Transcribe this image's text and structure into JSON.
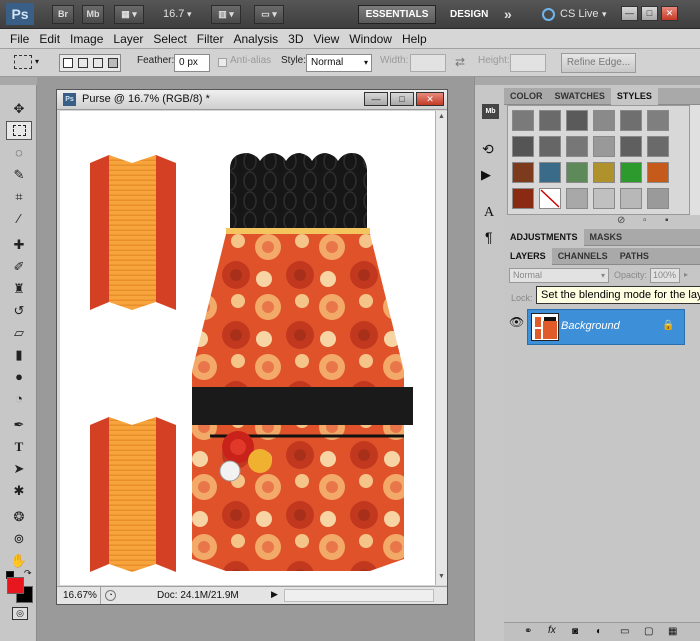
{
  "app": {
    "logo": "Ps",
    "bridge": "Br",
    "minibridge": "Mb",
    "zoom": "16.7",
    "workspace": "ESSENTIALS",
    "design": "DESIGN",
    "more": "»",
    "cslive": "CS Live",
    "cslive_arrow": "▾",
    "win_min": "—",
    "win_max": "□",
    "win_close": "✕"
  },
  "menu": [
    "File",
    "Edit",
    "Image",
    "Layer",
    "Select",
    "Filter",
    "Analysis",
    "3D",
    "View",
    "Window",
    "Help"
  ],
  "options": {
    "feather_label": "Feather:",
    "feather_value": "0 px",
    "antialias": "Anti-alias",
    "style_label": "Style:",
    "style_value": "Normal",
    "width_label": "Width:",
    "height_label": "Height:",
    "refine": "Refine Edge..."
  },
  "document": {
    "title": "Purse @ 16.7% (RGB/8) *",
    "zoom": "16.67%",
    "doc_info": "Doc: 24.1M/21.9M",
    "ps_icon": "Ps"
  },
  "panels": {
    "top_tabs": [
      "COLOR",
      "SWATCHES",
      "STYLES"
    ],
    "mid_tabs": [
      "ADJUSTMENTS",
      "MASKS"
    ],
    "layer_tabs": [
      "LAYERS",
      "CHANNELS",
      "PATHS"
    ],
    "blend_mode": "Normal",
    "opacity_label": "Opacity:",
    "opacity_value": "100%",
    "lock_label": "Lock:",
    "layer_name": "Background",
    "tooltip": "Set the blending mode for the layer"
  },
  "colors": {
    "foreground": "#e8161e",
    "background": "#000000",
    "selection": "#3d8fd8"
  }
}
